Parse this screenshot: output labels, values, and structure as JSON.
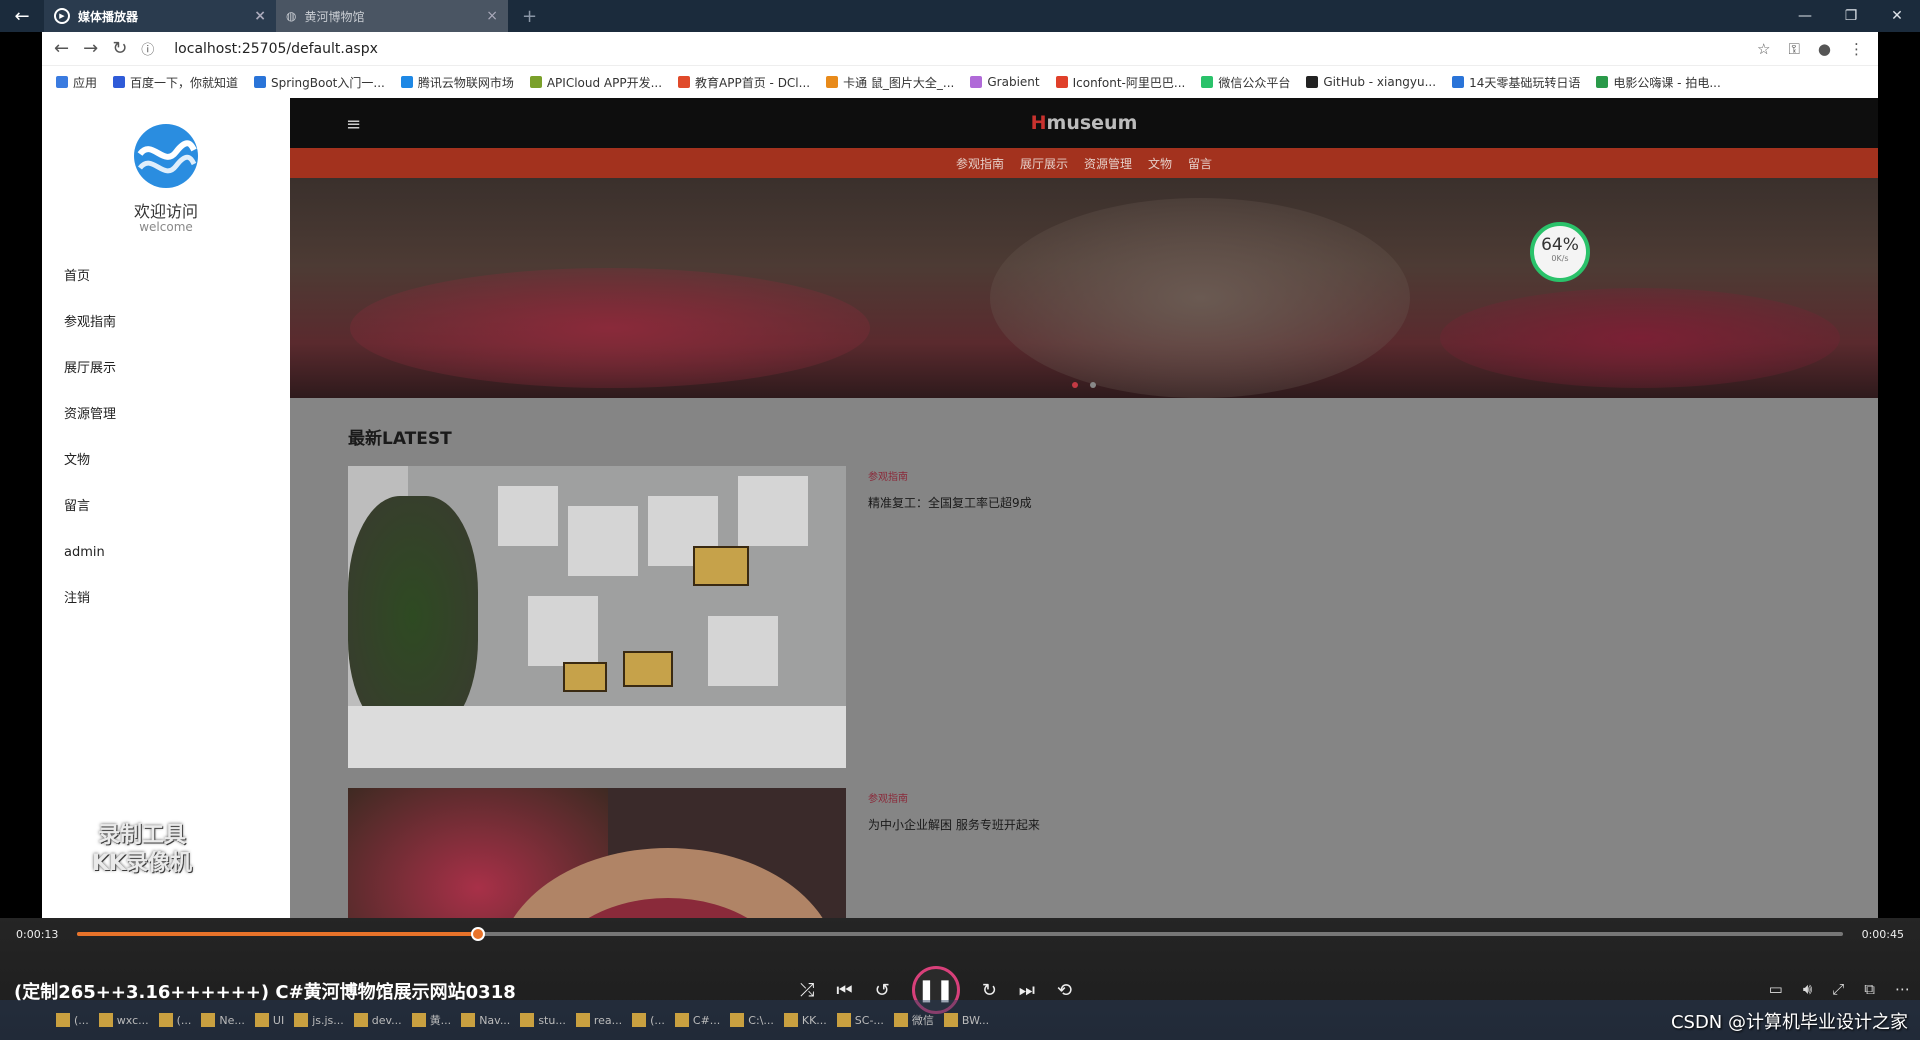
{
  "browser": {
    "tabs": [
      {
        "label": "媒体播放器",
        "active": true
      },
      {
        "label": "黄河博物馆",
        "active": false
      }
    ],
    "url": "localhost:25705/default.aspx",
    "bookmarks": [
      {
        "label": "应用",
        "color": "#3a7be0"
      },
      {
        "label": "百度一下，你就知道",
        "color": "#2f5bd8"
      },
      {
        "label": "SpringBoot入门一...",
        "color": "#2a74d8"
      },
      {
        "label": "腾讯云物联网市场",
        "color": "#1e88e5"
      },
      {
        "label": "APICloud APP开发...",
        "color": "#7aa02a"
      },
      {
        "label": "教育APP首页 - DCl...",
        "color": "#e04a2a"
      },
      {
        "label": "卡通 鼠_图片大全_...",
        "color": "#e88a1a"
      },
      {
        "label": "Grabient",
        "color": "#b06ad8"
      },
      {
        "label": "Iconfont-阿里巴巴...",
        "color": "#e0402a"
      },
      {
        "label": "微信公众平台",
        "color": "#2ac26a"
      },
      {
        "label": "GitHub - xiangyu...",
        "color": "#222222"
      },
      {
        "label": "14天零基础玩转日语",
        "color": "#2a74d8"
      },
      {
        "label": "电影公嗨课 - 拍电...",
        "color": "#2a9a4a"
      }
    ]
  },
  "sidebar": {
    "welcome": "欢迎访问",
    "welcome_en": "welcome",
    "items": [
      {
        "label": "首页"
      },
      {
        "label": "参观指南"
      },
      {
        "label": "展厅展示"
      },
      {
        "label": "资源管理"
      },
      {
        "label": "文物"
      },
      {
        "label": "留言"
      },
      {
        "label": "admin"
      },
      {
        "label": "注销"
      }
    ],
    "recorder_line1": "录制工具",
    "recorder_line2": "KK录像机"
  },
  "site": {
    "brand_h": "H",
    "brand_rest": "museum",
    "nav": [
      "参观指南",
      "展厅展示",
      "资源管理",
      "文物",
      "留言"
    ],
    "gauge_pct": "64%",
    "gauge_speed": "0K/s",
    "latest_heading": "最新LATEST",
    "news": [
      {
        "category": "参观指南",
        "title": "精准复工：全国复工率已超9成"
      },
      {
        "category": "参观指南",
        "title": "为中小企业解困 服务专班开起来"
      }
    ]
  },
  "player": {
    "time_current": "0:00:13",
    "time_total": "0:00:45",
    "progress": 0.227,
    "title": "(定制265++3.16++++++) C#黄河博物馆展示网站0318",
    "accent": "#e8732a"
  },
  "taskbar": {
    "items": [
      "(...",
      "wxc...",
      "(...",
      "Ne...",
      "UI",
      "js.js...",
      "dev...",
      "黄...",
      "Nav...",
      "stu...",
      "rea...",
      "(...",
      "C#...",
      "C:\\...",
      "KK...",
      "SC-...",
      "微信",
      "BW..."
    ]
  },
  "watermark": "CSDN @计算机毕业设计之家"
}
